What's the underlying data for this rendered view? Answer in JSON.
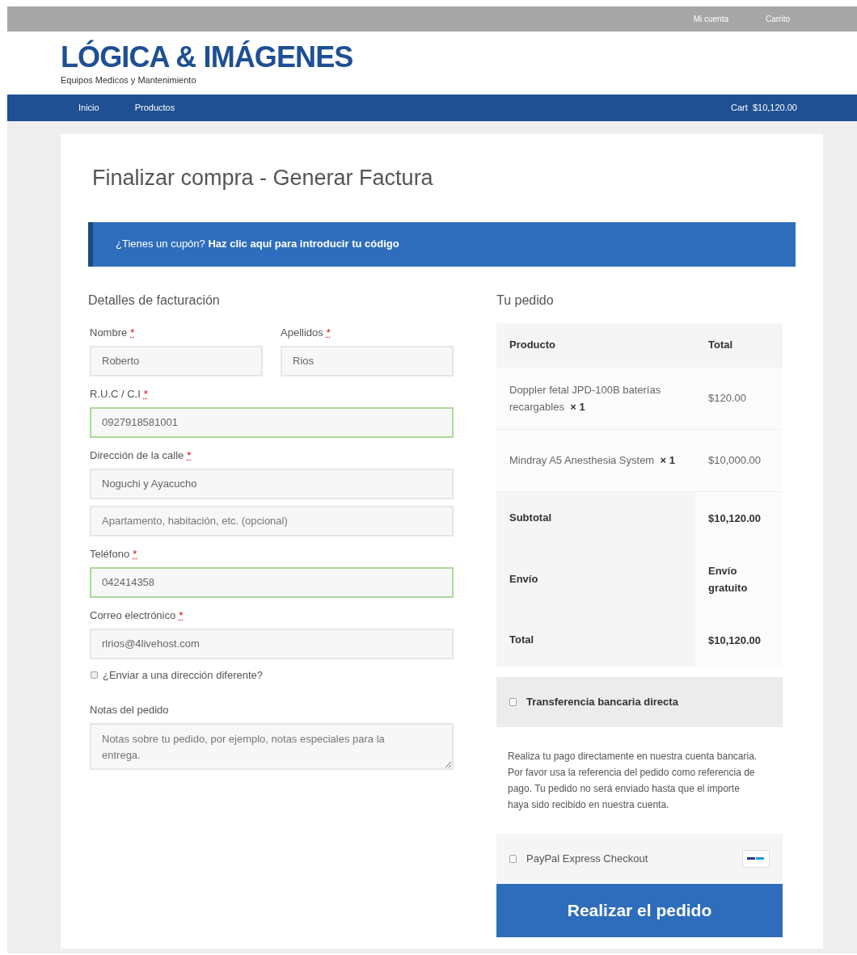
{
  "top_bar": {
    "links": [
      "Mi cuenta",
      "Carrito"
    ]
  },
  "header": {
    "logo": "LÓGICA & IMÁGENES",
    "tagline": "Equipos Medicos y Mantenimiento"
  },
  "nav": {
    "items": [
      "Inicio",
      "Productos"
    ],
    "cart_label": "Cart",
    "cart_total": "$10,120.00"
  },
  "page_title": "Finalizar compra - Generar Factura",
  "coupon_notice": "¿Tienes un cupón? **Haz clic aquí para introducir tu código**",
  "billing": {
    "title": "Detalles de facturación",
    "fields": [
      {
        "kind": "half",
        "label": "Nombre",
        "required_mark": "*",
        "value": "Roberto",
        "valid": false
      },
      {
        "kind": "half",
        "label": "Apellidos",
        "required_mark": "*",
        "value": "Rios",
        "valid": false
      },
      {
        "kind": "full",
        "label": "R.U.C / C.I",
        "required_mark": "*",
        "value": "0927918581001",
        "valid": true
      },
      {
        "kind": "full",
        "label": "Dirección de la calle",
        "required_mark": "*",
        "value": "Noguchi y Ayacucho",
        "valid": false
      },
      {
        "kind": "full",
        "placeholder": "Apartamento, habitación, etc. (opcional)",
        "valid": false
      },
      {
        "kind": "full",
        "label": "Teléfono",
        "required_mark": "*",
        "value": "042414358",
        "valid": true
      },
      {
        "kind": "full",
        "label": "Correo electrónico",
        "required_mark": "*",
        "value": "rlrios@4livehost.com",
        "valid": false
      }
    ],
    "ship_elsewhere": {
      "label": "¿Enviar a una dirección diferente?",
      "checked": false
    },
    "notes": {
      "label": "Notas del pedido",
      "placeholder": "Notas sobre tu pedido, por ejemplo, notas especiales para la entrega."
    }
  },
  "order": {
    "title": "Tu pedido",
    "columns": [
      "Producto",
      "Total"
    ],
    "items": [
      {
        "name": "Doppler fetal JPD-100B baterías recargables",
        "qty": "× 1",
        "total": "$120.00"
      },
      {
        "name": "Mindray A5 Anesthesia System",
        "qty": "× 1",
        "total": "$10,000.00"
      }
    ],
    "totals": [
      {
        "label": "Subtotal",
        "value": "$10,120.00"
      },
      {
        "label": "Envío",
        "value": "Envío gratuito"
      },
      {
        "label": "Total",
        "value": "$10,120.00"
      }
    ],
    "payment_methods": [
      {
        "kind": "bank",
        "label": "Transferencia bancaria directa",
        "selected": false,
        "description": "Realiza tu pago directamente en nuestra cuenta bancaria. Por favor usa la referencia del pedido como referencia de pago. Tu pedido no será enviado hasta que el importe haya sido recibido en nuestra cuenta."
      },
      {
        "kind": "paypal",
        "label": "PayPal Express Checkout",
        "selected": false
      }
    ],
    "place_order": "Realizar el pedido"
  }
}
